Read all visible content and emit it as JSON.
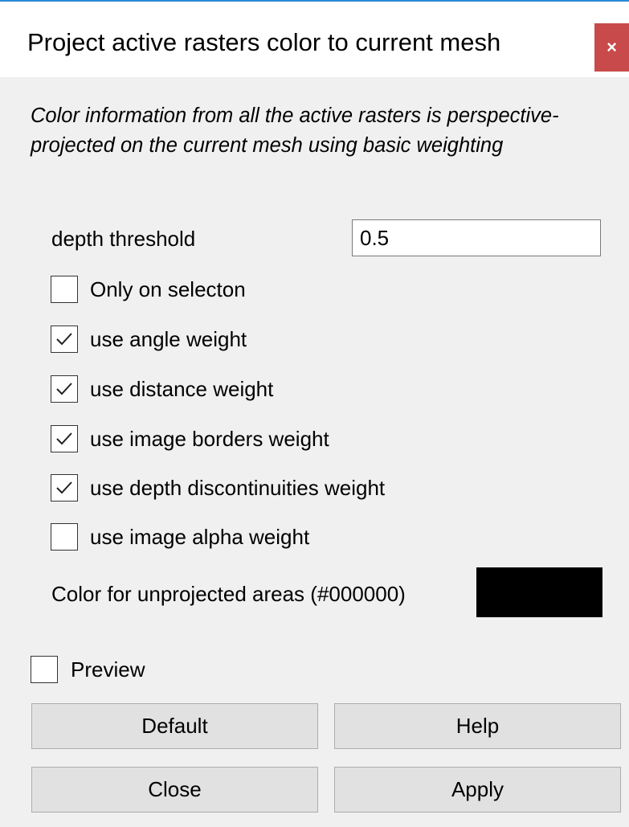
{
  "window": {
    "title": "Project active rasters color to current mesh",
    "close_label": "×"
  },
  "description": "Color information from all the active rasters is perspective-projected on the current mesh using basic weighting",
  "depth_threshold": {
    "label": "depth threshold",
    "value": "0.5"
  },
  "options": [
    {
      "label": "Only on selecton",
      "checked": false
    },
    {
      "label": "use angle weight",
      "checked": true
    },
    {
      "label": "use distance weight",
      "checked": true
    },
    {
      "label": "use image borders weight",
      "checked": true
    },
    {
      "label": "use depth discontinuities weight",
      "checked": true
    },
    {
      "label": "use image alpha weight",
      "checked": false
    }
  ],
  "unprojected_color": {
    "label": "Color for unprojected areas  (#000000)",
    "color": "#000000"
  },
  "preview": {
    "label": "Preview",
    "checked": false
  },
  "buttons": {
    "default": "Default",
    "help": "Help",
    "close": "Close",
    "apply": "Apply"
  }
}
